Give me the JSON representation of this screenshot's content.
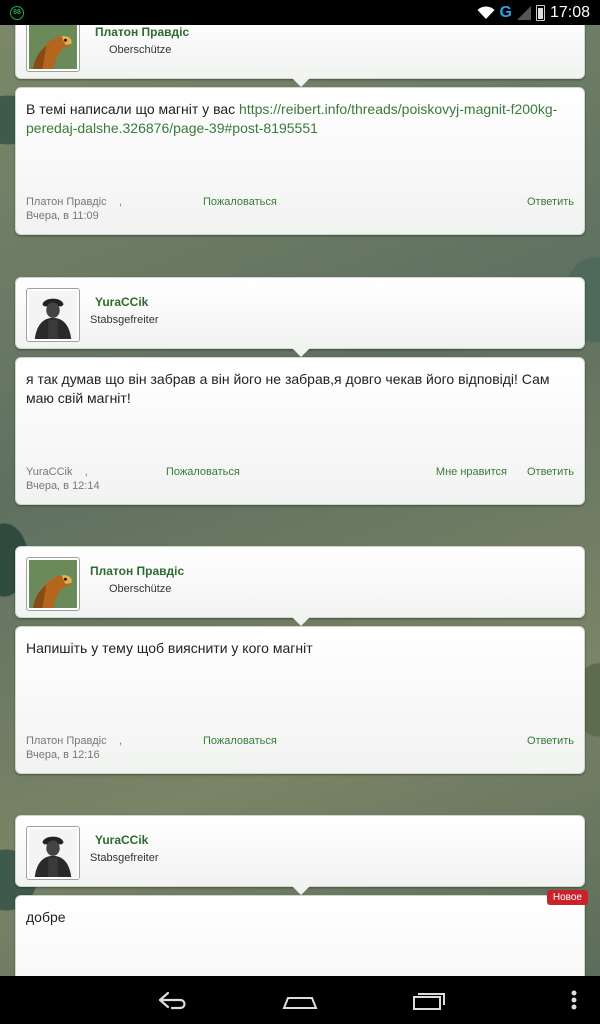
{
  "status_bar": {
    "notification_count": "88",
    "network_type": "G",
    "time": "17:08"
  },
  "posts": [
    {
      "author": {
        "name": "Платон Правдіс",
        "rank": "Oberschütze"
      },
      "text": "В темі написали що магніт у вас ",
      "link": "https://reibert.info/threads/poiskovyj-magnit-f200kg-peredaj-dalshe.326876/page-39#post-8195551",
      "footer": {
        "author": "Платон Правдіс",
        "separator": ",",
        "date": "Вчера, в 11:09",
        "report": "Пожаловаться",
        "reply": "Ответить"
      }
    },
    {
      "author": {
        "name": "YuraCCik",
        "rank": "Stabsgefreiter"
      },
      "text": "я так думав що він забрав а він його не забрав,я довго чекав його відповіді! Сам маю свій магніт!",
      "footer": {
        "author": "YuraCCik",
        "separator": ",",
        "date": "Вчера, в 12:14",
        "report": "Пожаловаться",
        "like": "Мне нравится",
        "reply": "Ответить"
      }
    },
    {
      "author": {
        "name": "Платон Правдіс",
        "rank": "Oberschütze"
      },
      "text": "Напишіть у тему щоб вияснити у кого магніт",
      "footer": {
        "author": "Платон Правдіс",
        "separator": ",",
        "date": "Вчера, в 12:16",
        "report": "Пожаловаться",
        "reply": "Ответить"
      }
    },
    {
      "author": {
        "name": "YuraCCik",
        "rank": "Stabsgefreiter"
      },
      "text": "добре",
      "badge": "Новое"
    }
  ],
  "icons": {
    "back": "back-icon",
    "home": "home-icon",
    "recents": "recent-apps-icon",
    "menu": "overflow-menu-icon"
  },
  "colors": {
    "username": "#2f6a2f",
    "link": "#3a7a3a",
    "new_badge": "#c8222a"
  }
}
